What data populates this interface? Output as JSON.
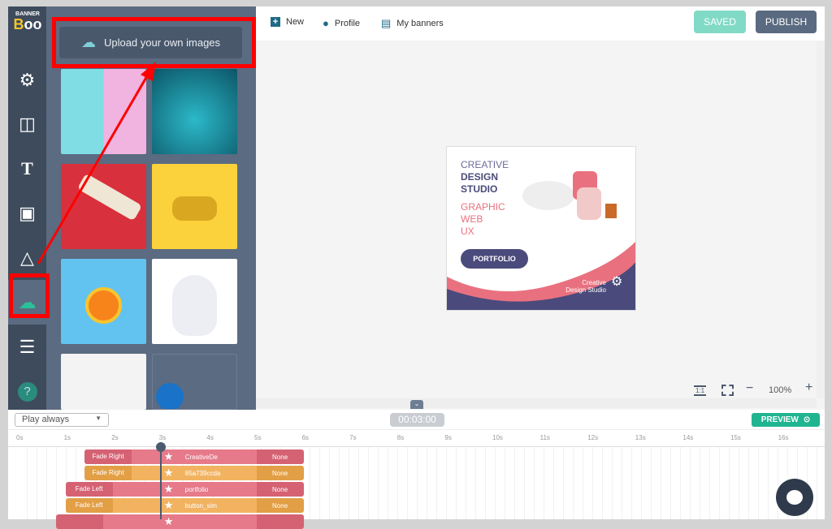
{
  "logo": {
    "text": "BANNER BOO"
  },
  "sidebar": {
    "items": [
      {
        "name": "settings",
        "icon": "gear-icon",
        "glyph": "⚙"
      },
      {
        "name": "layouts",
        "icon": "layout-icon",
        "glyph": "◫"
      },
      {
        "name": "text",
        "icon": "text-icon",
        "glyph": "T"
      },
      {
        "name": "images",
        "icon": "image-icon",
        "glyph": "▣"
      },
      {
        "name": "shapes",
        "icon": "shapes-icon",
        "glyph": "△"
      },
      {
        "name": "uploads",
        "icon": "cloud-upload-icon",
        "glyph": "☁",
        "active": true
      },
      {
        "name": "adjust",
        "icon": "sliders-icon",
        "glyph": "☰"
      },
      {
        "name": "help",
        "icon": "help-icon",
        "glyph": "?"
      }
    ]
  },
  "panel": {
    "upload_label": "Upload your own images"
  },
  "topbar": {
    "new": "New",
    "profile": "Profile",
    "my_banners": "My banners",
    "saved": "SAVED",
    "publish": "PUBLISH"
  },
  "banner": {
    "line1": "CREATIVE",
    "line2": "DESIGN",
    "line3": "STUDIO",
    "s1": "GRAPHIC",
    "s2": "WEB",
    "s3": "UX",
    "button": "PORTFOLIO",
    "footer1": "Creative",
    "footer2": "Design Studio"
  },
  "zoom": {
    "level": "100%",
    "fit": "1:1"
  },
  "timeline": {
    "play_mode": "Play always",
    "time": "00:03:00",
    "preview": "PREVIEW",
    "playhead_seconds": 3,
    "ticks": [
      "0s",
      "1s",
      "2s",
      "3s",
      "4s",
      "5s",
      "6s",
      "7s",
      "8s",
      "9s",
      "10s",
      "11s",
      "12s",
      "13s",
      "14s",
      "15s",
      "16s"
    ],
    "rows": [
      {
        "in": "Fade Right",
        "name": "CreativeDe",
        "out": "None",
        "color": "#e2687a",
        "start": 1.4,
        "end": 6
      },
      {
        "in": "Fade Right",
        "name": "85a739ccda",
        "out": "None",
        "color": "#f0a94a",
        "start": 1.4,
        "end": 6
      },
      {
        "in": "Fade Left",
        "name": "portfolio",
        "out": "None",
        "color": "#e2687a",
        "start": 1,
        "end": 6
      },
      {
        "in": "Fade Left",
        "name": "button_sim",
        "out": "None",
        "color": "#f0a94a",
        "start": 1,
        "end": 6
      },
      {
        "in": "",
        "name": "",
        "out": "",
        "color": "#e2687a",
        "start": 0.8,
        "end": 6
      }
    ]
  },
  "colors": {
    "accent": "#2bbf9a",
    "highlight": "#ff0000",
    "navy": "#4a4a7c",
    "pink": "#e9717f"
  }
}
